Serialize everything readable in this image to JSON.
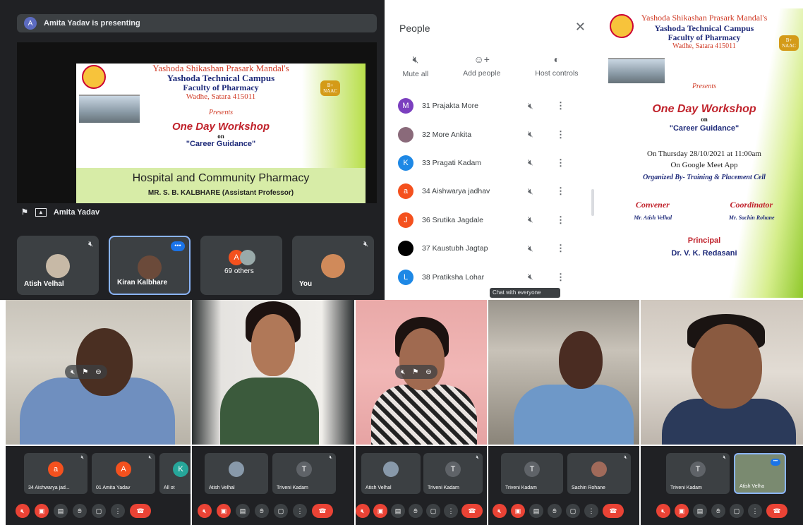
{
  "presenting_bar": {
    "avatar": "A",
    "text": "Amita Yadav is presenting"
  },
  "presenter_label": "Amita Yadav",
  "slide": {
    "org": "Yashoda Shikashan Prasark Mandal's",
    "campus": "Yashoda Technical Campus",
    "faculty": "Faculty of Pharmacy",
    "address": "Wadhe, Satara 415011",
    "logo": "YSPM",
    "badge": "B+ NAAC",
    "presents": "Presents",
    "workshop": "One Day Workshop",
    "on": "on",
    "topic": "\"Career Guidance\"",
    "subject": "Hospital and Community Pharmacy",
    "speaker": "MR. S. B. KALBHARE (Assistant Professor)",
    "date": "On Thursday 28/10/2021 at 11:00am",
    "app": "On Google Meet App",
    "organized": "Organized By- Training & Placement Cell",
    "convener_label": "Convener",
    "coordinator_label": "Coordinator",
    "convener_name": "Mr. Atish Velhal",
    "coordinator_name": "Mr. Sachin Rohane",
    "principal_label": "Principal",
    "principal_name": "Dr. V. K. Redasani"
  },
  "tiles": [
    {
      "name": "Atish Velhal"
    },
    {
      "name": "Kiran Kalbhare",
      "more": "•••"
    },
    {
      "name": "69 others",
      "avatar": "A"
    },
    {
      "name": "You"
    }
  ],
  "people_panel": {
    "title": "People",
    "close": "✕",
    "actions": [
      {
        "label": "Mute all",
        "icon": "mic-off-icon"
      },
      {
        "label": "Add people",
        "icon": "add-person-icon"
      },
      {
        "label": "Host controls",
        "icon": "toggle-icon"
      }
    ],
    "participants": [
      {
        "initial": "M",
        "name": "31 Prajakta More",
        "color": "#7b3fbf"
      },
      {
        "initial": "",
        "name": "32 More Ankita",
        "color": "#8a6a7a"
      },
      {
        "initial": "K",
        "name": "33 Pragati Kadam",
        "color": "#1e88e5"
      },
      {
        "initial": "a",
        "name": "34 Aishwarya jadhav",
        "color": "#f4511e"
      },
      {
        "initial": "J",
        "name": "36 Srutika Jagdale",
        "color": "#f4511e"
      },
      {
        "initial": "",
        "name": "37 Kaustubh Jagtap",
        "color": "#000000"
      },
      {
        "initial": "L",
        "name": "38 Pratiksha Lohar",
        "color": "#1e88e5"
      }
    ],
    "tooltip": "Chat with everyone"
  },
  "strips": [
    {
      "thumbs": [
        {
          "name": "34 Aishwarya jad...",
          "avatar": "a",
          "color": "#f4511e"
        },
        {
          "name": "01 Amita Yadav",
          "avatar": "A",
          "color": "#f4511e"
        },
        {
          "name": "All ot",
          "avatar": "K",
          "color": "#26a69a"
        }
      ]
    },
    {
      "thumbs": [
        {
          "name": "Atish Velhal",
          "avatar": "",
          "color": "#8899aa"
        },
        {
          "name": "Triveni Kadam",
          "avatar": "T",
          "color": "#5f6368"
        }
      ]
    },
    {
      "thumbs": [
        {
          "name": "Atish Velhal",
          "avatar": "",
          "color": "#8899aa"
        },
        {
          "name": "Triveni Kadam",
          "avatar": "T",
          "color": "#5f6368"
        }
      ]
    },
    {
      "thumbs": [
        {
          "name": "Triveni Kadam",
          "avatar": "T",
          "color": "#5f6368"
        },
        {
          "name": "Sachin Rohane",
          "avatar": "",
          "color": "#a06a5a"
        }
      ]
    },
    {
      "thumbs": [
        {
          "name": "Triveni Kadam",
          "avatar": "T",
          "color": "#5f6368"
        },
        {
          "name": "Atish Velha",
          "avatar": "",
          "color": "#7a8a70"
        }
      ]
    }
  ],
  "colors": {
    "meet_bg": "#202124",
    "tile_bg": "#3c4043",
    "accent": "#8ab4f8",
    "end_call": "#ea4335"
  }
}
